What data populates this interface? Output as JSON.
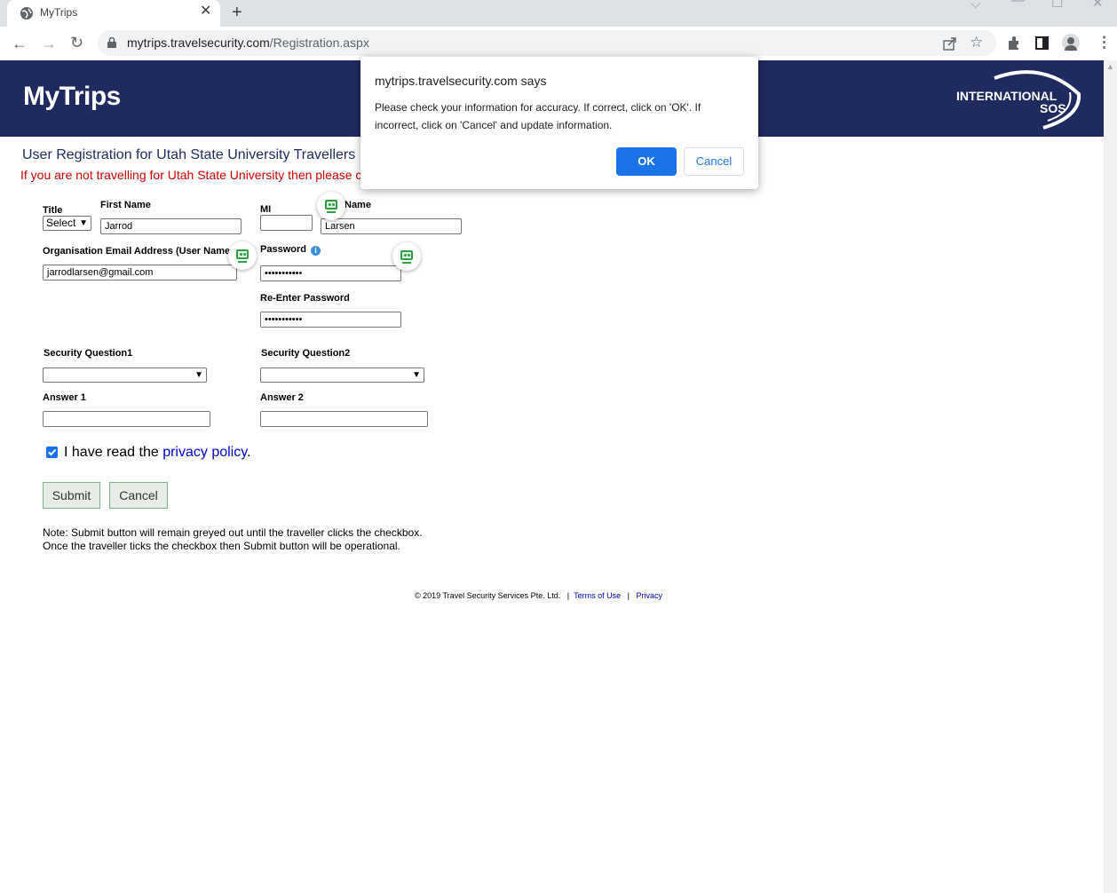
{
  "browser": {
    "tab_title": "MyTrips",
    "url_host": "mytrips.travelsecurity.com",
    "url_path": "/Registration.aspx"
  },
  "header": {
    "logo": "MyTrips",
    "sos_line1": "INTERNATIONAL",
    "sos_line2": "SOS"
  },
  "page": {
    "title": "User Registration for Utah State University Travellers",
    "notice": "If you are not travelling for Utah State University then please c"
  },
  "form": {
    "title_label": "Title",
    "title_value": "Select",
    "first_name_label": "First Name",
    "first_name_value": "Jarrod",
    "mi_label": "MI",
    "mi_value": "",
    "last_name_label": "Name",
    "last_name_value": "Larsen",
    "email_label": "Organisation Email Address (User Name",
    "email_value": "jarrodlarsen@gmail.com",
    "password_label": "Password",
    "password_value": "•••••••••••",
    "reenter_label": "Re-Enter Password",
    "reenter_value": "•••••••••••",
    "sq1_label": "Security Question1",
    "sq2_label": "Security Question2",
    "answer1_label": "Answer 1",
    "answer2_label": "Answer 2",
    "privacy_prefix": "I have read the ",
    "privacy_link": "privacy policy",
    "privacy_suffix": ".",
    "submit": "Submit",
    "cancel": "Cancel",
    "note": "Note: Submit button will remain greyed out until the traveller clicks the checkbox. Once the traveller ticks the checkbox then Submit button will be operational."
  },
  "footer": {
    "copyright": "© 2019 Travel Security Services Pte. Ltd.",
    "sep": "|",
    "terms": "Terms of Use",
    "privacy": "Privacy"
  },
  "dialog": {
    "title": "mytrips.travelsecurity.com says",
    "message": "Please check your information for accuracy. If correct, click on 'OK'.  If incorrect, click on 'Cancel' and update information.",
    "ok": "OK",
    "cancel": "Cancel"
  },
  "colors": {
    "header_bg": "#1f2a5e",
    "notice": "#cc0000",
    "accent": "#1a73e8"
  }
}
